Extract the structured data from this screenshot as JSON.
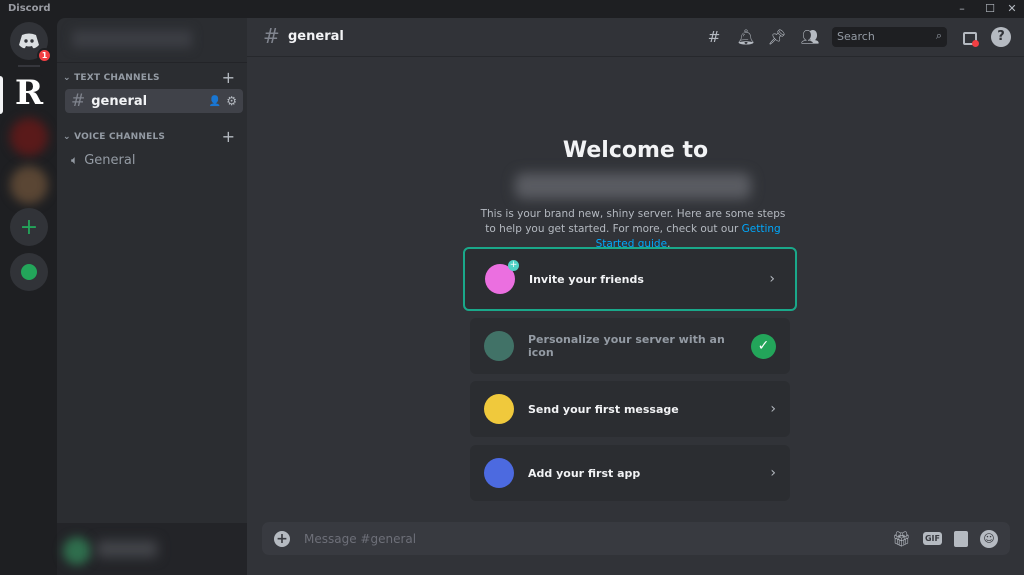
{
  "window": {
    "title": "Discord",
    "controls": [
      "minimize",
      "maximize",
      "close"
    ]
  },
  "rail": {
    "home_badge": "1",
    "servers": [
      "R server",
      "blurred server 1",
      "blurred server 2"
    ],
    "add_server": "add-server",
    "explore": "explore"
  },
  "sidebar": {
    "categories": [
      {
        "label": "TEXT CHANNELS",
        "channels": [
          {
            "name": "general",
            "type": "text",
            "selected": true
          }
        ]
      },
      {
        "label": "VOICE CHANNELS",
        "channels": [
          {
            "name": "General",
            "type": "voice"
          }
        ]
      }
    ]
  },
  "header": {
    "channel": "general",
    "search_placeholder": "Search",
    "icons": [
      "threads-icon",
      "bell-icon",
      "pin-icon",
      "members-icon",
      "inbox-icon",
      "help-icon"
    ]
  },
  "welcome": {
    "title": "Welcome to",
    "description": "This is your brand new, shiny server. Here are some steps to help you get started. For more, check out our ",
    "link": "Getting Started guide",
    "link_end": ".",
    "steps": [
      {
        "label": "Invite your friends",
        "done": false,
        "highlighted": true
      },
      {
        "label": "Personalize your server with an icon",
        "done": true
      },
      {
        "label": "Send your first message",
        "done": false
      },
      {
        "label": "Add your first app",
        "done": false
      }
    ]
  },
  "composer": {
    "placeholder": "Message #general",
    "gif": "GIF"
  },
  "colors": {
    "accent": "#5865f2",
    "highlight": "#1aa88a",
    "success": "#23a55a",
    "link": "#00a8fc",
    "badge": "#f23f43"
  }
}
